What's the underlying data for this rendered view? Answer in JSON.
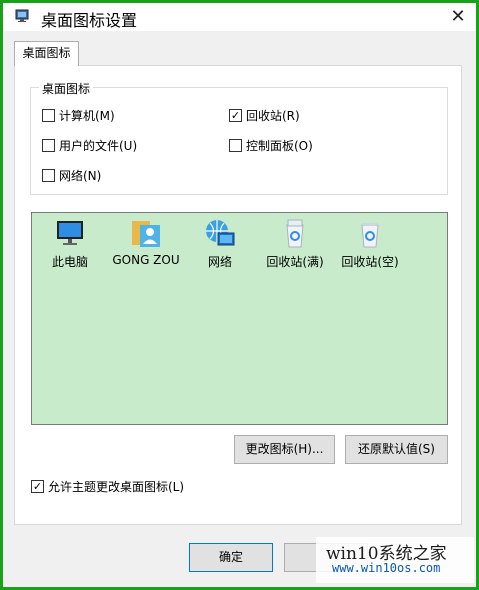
{
  "window": {
    "title": "桌面图标设置",
    "close_glyph": "✕"
  },
  "tabs": [
    {
      "label": "桌面图标"
    }
  ],
  "desktop_icons_group": {
    "label": "桌面图标",
    "checkboxes": [
      {
        "label": "计算机(M)",
        "checked": false
      },
      {
        "label": "回收站(R)",
        "checked": true
      },
      {
        "label": "用户的文件(U)",
        "checked": false
      },
      {
        "label": "控制面板(O)",
        "checked": false
      },
      {
        "label": "网络(N)",
        "checked": false
      }
    ]
  },
  "icon_list": [
    {
      "label": "此电脑",
      "icon": "monitor-icon"
    },
    {
      "label": "GONG ZOU",
      "icon": "user-folder-icon"
    },
    {
      "label": "网络",
      "icon": "network-globe-icon"
    },
    {
      "label": "回收站(满)",
      "icon": "recycle-bin-full-icon"
    },
    {
      "label": "回收站(空)",
      "icon": "recycle-bin-empty-icon"
    }
  ],
  "buttons": {
    "change_icon": "更改图标(H)...",
    "restore_default": "还原默认值(S)",
    "ok": "确定",
    "cancel": ""
  },
  "allow_themes": {
    "label": "允许主题更改桌面图标(L)",
    "checked": true
  },
  "watermark": {
    "line1": "win10系统之家",
    "line2": "www.win10os.com"
  },
  "colors": {
    "frame_border": "#1aa11a",
    "icon_view_bg": "#c8ebcb",
    "primary_button_border": "#0078d7"
  }
}
